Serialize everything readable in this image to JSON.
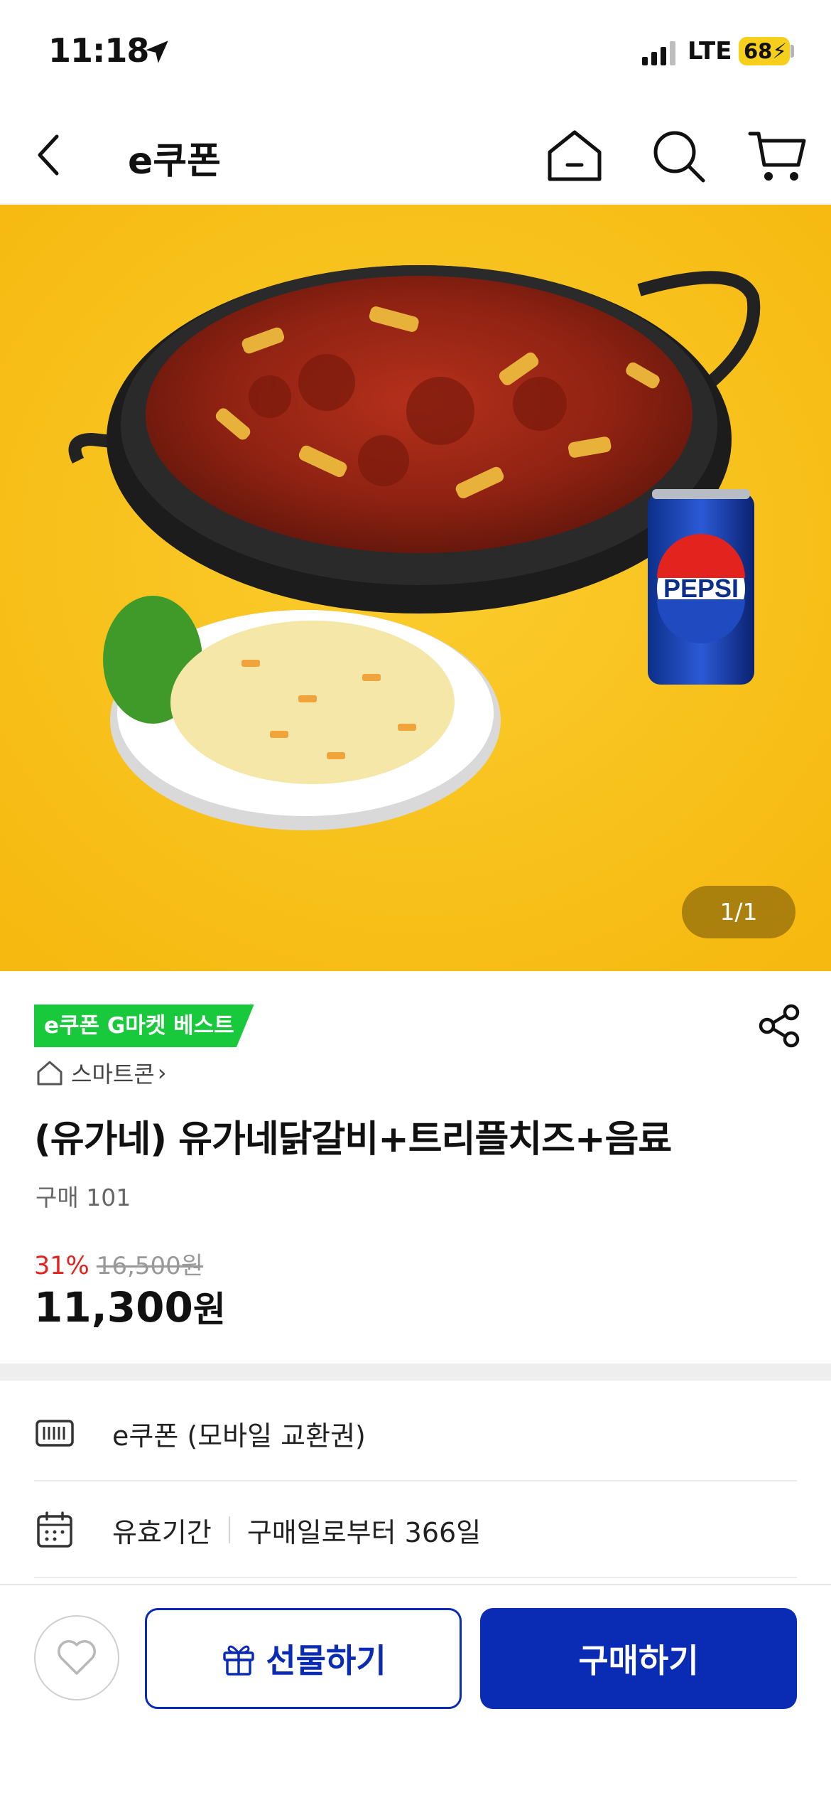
{
  "status_bar": {
    "time": "11:18",
    "network": "LTE",
    "battery": "68"
  },
  "nav": {
    "title": "e쿠폰",
    "icons": [
      "back-icon",
      "home-icon",
      "search-icon",
      "cart-icon"
    ]
  },
  "hero": {
    "pager": "1/1",
    "can_brand": "PEPSI",
    "background_color": "#f9c21f"
  },
  "product": {
    "badge": "e쿠폰 G마켓 베스트",
    "seller": "스마트콘",
    "seller_chevron": "›",
    "title": "(유가네) 유가네닭갈비+트리플치즈+음료",
    "purchase_count": "구매 101",
    "discount_rate": "31%",
    "original_price": "16,500원",
    "final_price_number": "11,300",
    "final_price_unit": "원"
  },
  "info_rows": [
    {
      "icon": "barcode-icon",
      "text": "e쿠폰 (모바일 교환권)"
    },
    {
      "icon": "calendar-icon",
      "label": "유효기간",
      "value": "구매일로부터 366일"
    }
  ],
  "bottom_bar": {
    "wish_icon": "heart-icon",
    "gift_label": "선물하기",
    "buy_label": "구매하기"
  },
  "colors": {
    "accent": "#0a2bb3",
    "badge_green": "#19c93c",
    "discount_red": "#e3231d"
  }
}
